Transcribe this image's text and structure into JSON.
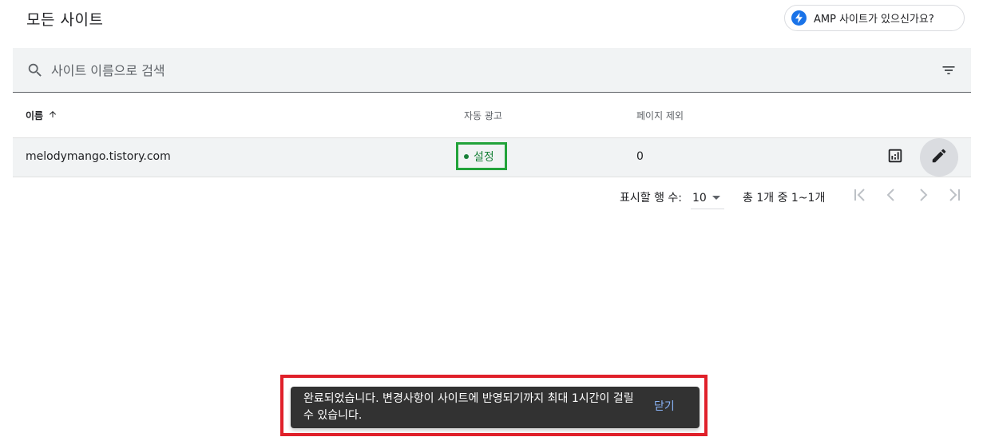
{
  "header": {
    "title": "모든 사이트",
    "amp_chip_label": "AMP 사이트가 있으신가요?"
  },
  "search": {
    "placeholder": "사이트 이름으로 검색",
    "search_icon": "search-icon",
    "filter_icon": "filter-icon"
  },
  "table": {
    "columns": [
      {
        "label": "이름",
        "sort_icon": "arrow-up-icon"
      },
      {
        "label": "자동 광고"
      },
      {
        "label": "페이지 제외"
      }
    ],
    "rows": [
      {
        "site": "melodymango.tistory.com",
        "auto_ads": "설정",
        "excluded_pages": "0",
        "report_icon": "report-chart-icon",
        "edit_icon": "edit-pencil-icon"
      }
    ]
  },
  "paginator": {
    "rows_label": "표시할 행 수:",
    "rows_value": "10",
    "range_label": "총 1개 중 1~1개"
  },
  "snackbar": {
    "message": "완료되었습니다. 변경사항이 사이트에 반영되기까지 최대 1시간이 걸릴 수 있습니다.",
    "action": "닫기"
  },
  "colors": {
    "accent": "#1a73e8",
    "status_on": "#188038",
    "highlight_green": "#22a33a",
    "highlight_red": "#e0202a",
    "snackbar_bg": "#323232",
    "snackbar_action": "#8ab4f8"
  }
}
